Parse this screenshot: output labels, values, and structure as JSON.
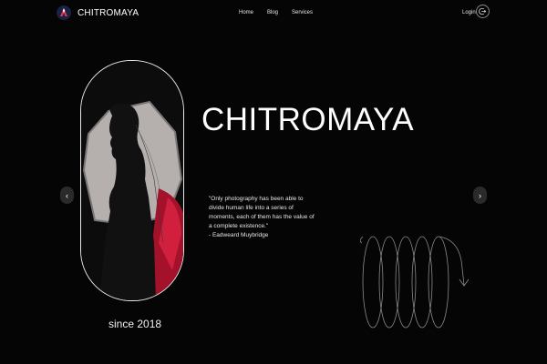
{
  "header": {
    "brand": "CHITROMAYA",
    "nav": [
      "Home",
      "Blog",
      "Services"
    ],
    "login": "Login"
  },
  "hero": {
    "title": "CHITROMAYA",
    "quote_lines": [
      "\"Only photography has been able to",
      "divide human life into a series of",
      "moments, each of them has the value of",
      "a complete existence.\"",
      "- Eadweard Muybridge"
    ],
    "since": "since 2018"
  },
  "controls": {
    "prev": "‹",
    "next": "›"
  },
  "colors": {
    "background": "#050505",
    "accent_red": "#b0122b",
    "frame": "#e8e8e8"
  },
  "icons": [
    "logo-icon",
    "logout-icon",
    "chevron-left-icon",
    "chevron-right-icon",
    "spiral-graphic"
  ]
}
